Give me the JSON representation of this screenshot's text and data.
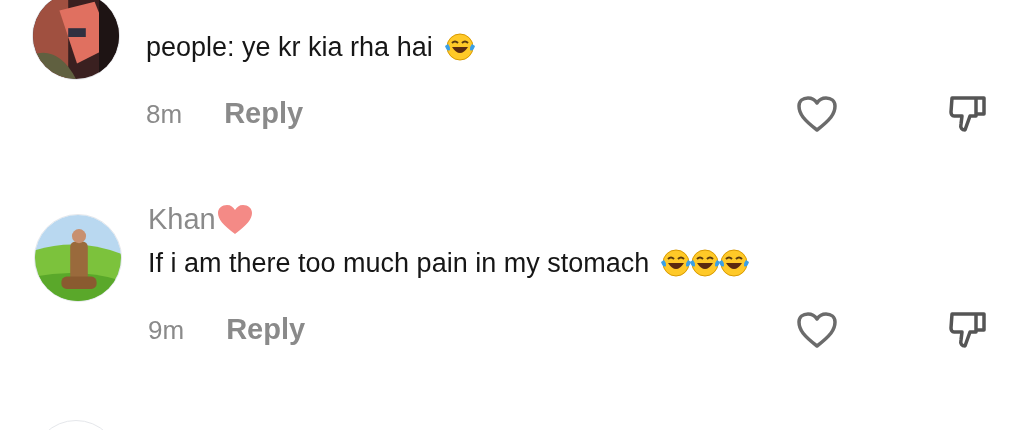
{
  "comments": [
    {
      "avatar": {
        "kind": "picture"
      },
      "text": "people: ye kr kia rha hai",
      "emojis": [
        {
          "kind": "laugh"
        }
      ],
      "time": "8m",
      "reply": "Reply",
      "liked": false
    },
    {
      "avatar": {
        "kind": "picture"
      },
      "name": "Khan",
      "name_badge": {
        "kind": "heart"
      },
      "text": "If i am there too much pain in my stomach",
      "emojis": [
        {
          "kind": "laugh"
        },
        {
          "kind": "laugh"
        },
        {
          "kind": "laugh"
        }
      ],
      "time": "9m",
      "reply": "Reply",
      "liked": false
    }
  ]
}
